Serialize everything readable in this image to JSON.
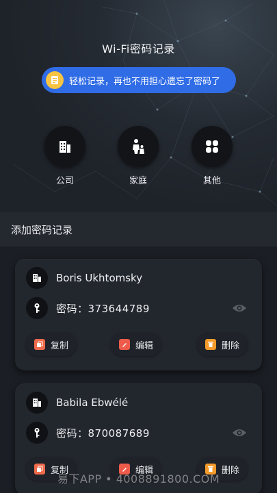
{
  "header": {
    "title": "Wi-Fi密码记录",
    "banner_text": "轻松记录，再也不用担心遗忘了密码了"
  },
  "categories": [
    {
      "label": "公司",
      "icon": "building-icon"
    },
    {
      "label": "家庭",
      "icon": "family-icon"
    },
    {
      "label": "其他",
      "icon": "grid-icon"
    }
  ],
  "section": {
    "title": "添加密码记录"
  },
  "records": [
    {
      "name": "Boris Ukhtomsky",
      "password_text": "密码：373644789"
    },
    {
      "name": "Babila Ebwélé",
      "password_text": "密码：870087689"
    }
  ],
  "actions": {
    "copy": "复制",
    "edit": "编辑",
    "delete": "删除"
  },
  "watermark": "易下APP • 4008891800.COM",
  "colors": {
    "accent": "#2f6ce6",
    "background": "#1d2027",
    "card": "#22262d"
  }
}
